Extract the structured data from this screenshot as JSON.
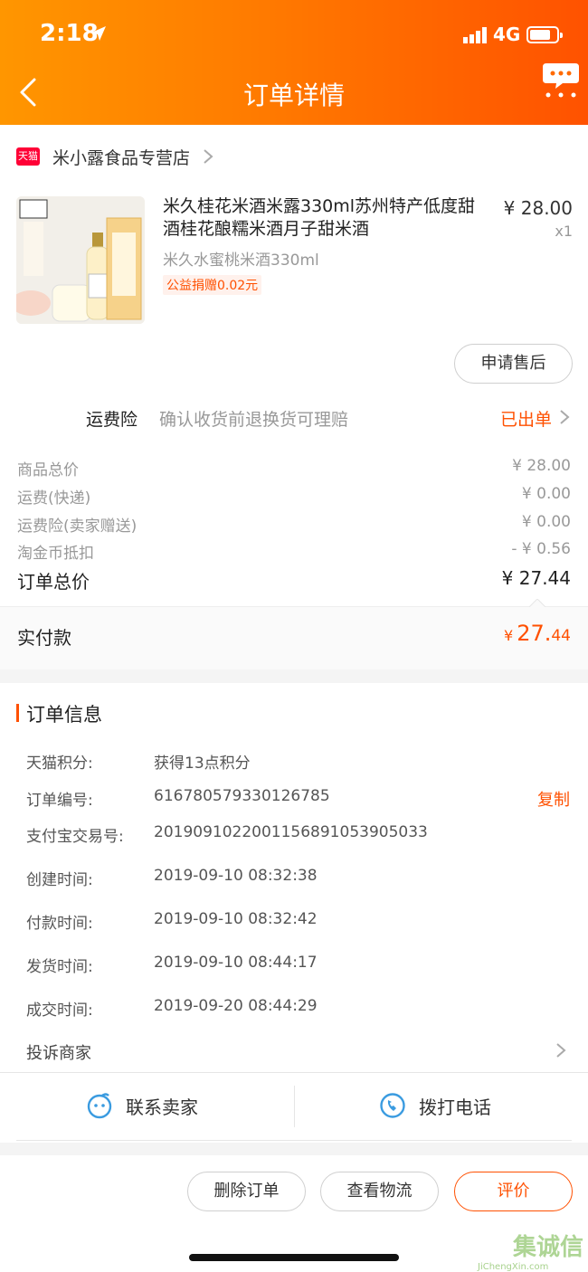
{
  "status_bar": {
    "time": "2:18",
    "network": "4G"
  },
  "nav": {
    "title": "订单详情"
  },
  "store": {
    "badge": "天猫",
    "name": "米小露食品专营店"
  },
  "product": {
    "title": "米久桂花米酒米露330ml苏州特产低度甜酒桂花酿糯米酒月子甜米酒",
    "sku": "米久水蜜桃米酒330ml",
    "tag": "公益捐赠0.02元",
    "price": "¥ 28.00",
    "qty": "x1"
  },
  "after_sale_button": "申请售后",
  "insurance": {
    "label": "运费险",
    "desc": "确认收货前退换货可理赔",
    "status": "已出单"
  },
  "fees": [
    {
      "label": "商品总价",
      "value": "¥ 28.00"
    },
    {
      "label": "运费(快递)",
      "value": "¥ 0.00"
    },
    {
      "label": "运费险(卖家赠送)",
      "value": "¥ 0.00"
    },
    {
      "label": "淘金币抵扣",
      "value": "- ¥ 0.56"
    }
  ],
  "order_total": {
    "label": "订单总价",
    "value": "¥ 27.44"
  },
  "paid": {
    "label": "实付款",
    "currency": "¥",
    "integer": "27.",
    "decimal": "44"
  },
  "order_info": {
    "title": "订单信息",
    "rows": [
      {
        "label": "天猫积分:",
        "value": "获得13点积分"
      },
      {
        "label": "订单编号:",
        "value": "616780579330126785"
      },
      {
        "label": "支付宝交易号:",
        "value": "2019091022001156891053905033"
      },
      {
        "label": "创建时间:",
        "value": "2019-09-10 08:32:38"
      },
      {
        "label": "付款时间:",
        "value": "2019-09-10 08:32:42"
      },
      {
        "label": "发货时间:",
        "value": "2019-09-10 08:44:17"
      },
      {
        "label": "成交时间:",
        "value": "2019-09-20 08:44:29"
      }
    ],
    "copy": "复制",
    "complain": "投诉商家"
  },
  "contact": {
    "seller": "联系卖家",
    "call": "拨打电话"
  },
  "bottom_buttons": {
    "delete": "删除订单",
    "logistics": "查看物流",
    "review": "评价"
  },
  "watermark": {
    "text": "集诚信",
    "sub": "JiChengXin.com"
  },
  "colors": {
    "accent": "#ff5000",
    "header_start": "#ff9600",
    "header_end": "#ff5200",
    "link_blue": "#3a9be0"
  }
}
